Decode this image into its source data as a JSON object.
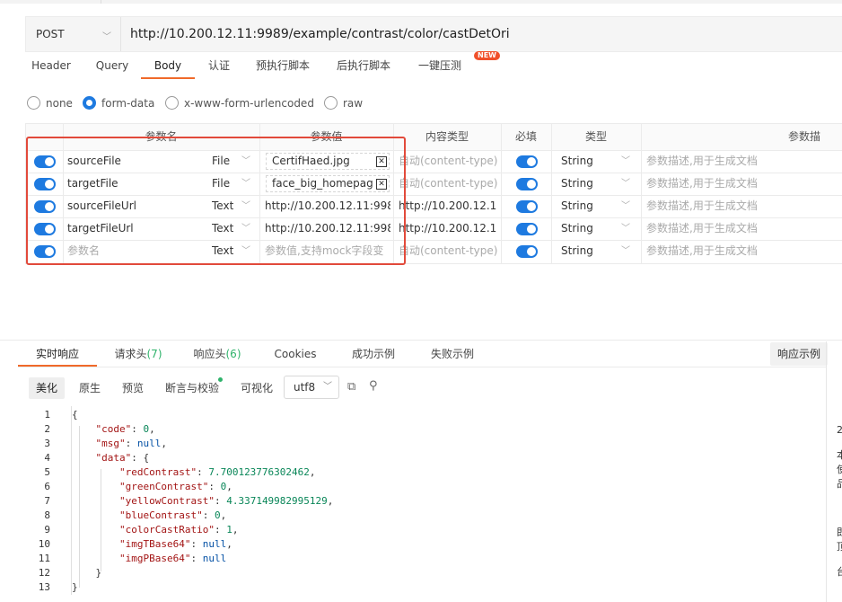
{
  "request": {
    "method": "POST",
    "url": "http://10.200.12.11:9989/example/contrast/color/castDetOri",
    "tabs": [
      "Header",
      "Query",
      "Body",
      "认证",
      "预执行脚本",
      "后执行脚本",
      "一键压测"
    ],
    "active_tab": "Body",
    "new_badge": "NEW"
  },
  "body_modes": {
    "options": [
      "none",
      "form-data",
      "x-www-form-urlencoded",
      "raw"
    ],
    "selected": "form-data"
  },
  "params_table": {
    "headers": [
      "参数名",
      "参数值",
      "内容类型",
      "必填",
      "类型",
      "参数描"
    ],
    "rows": [
      {
        "name": "sourceFile",
        "kind": "File",
        "value": "CertifHaed.jpg",
        "content_type": "自动(content-type)",
        "type": "String",
        "desc": "参数描述,用于生成文档"
      },
      {
        "name": "targetFile",
        "kind": "File",
        "value": "face_big_homepage",
        "content_type": "自动(content-type)",
        "type": "String",
        "desc": "参数描述,用于生成文档"
      },
      {
        "name": "sourceFileUrl",
        "kind": "Text",
        "value": "http://10.200.12.11:998",
        "content_type": "http://10.200.12.1",
        "type": "String",
        "desc": "参数描述,用于生成文档"
      },
      {
        "name": "targetFileUrl",
        "kind": "Text",
        "value": "http://10.200.12.11:998",
        "content_type": "http://10.200.12.1",
        "type": "String",
        "desc": "参数描述,用于生成文档"
      }
    ],
    "new_row": {
      "name_placeholder": "参数名",
      "kind": "Text",
      "value_placeholder": "参数值,支持mock字段变",
      "content_type_placeholder": "自动(content-type)",
      "type": "String",
      "desc_placeholder": "参数描述,用于生成文档"
    }
  },
  "response": {
    "tabs": [
      {
        "label": "实时响应"
      },
      {
        "label": "请求头",
        "count": "(7)"
      },
      {
        "label": "响应头",
        "count": "(6)"
      },
      {
        "label": "Cookies"
      },
      {
        "label": "成功示例"
      },
      {
        "label": "失败示例"
      }
    ],
    "example_button": "响应示例",
    "view_tabs": [
      "美化",
      "原生",
      "预览",
      "断言与校验",
      "可视化"
    ],
    "encoding": "utf8",
    "line_numbers": [
      "1",
      "2",
      "3",
      "4",
      "5",
      "6",
      "7",
      "8",
      "9",
      "10",
      "11",
      "12",
      "13"
    ],
    "json": {
      "code": "0",
      "msg": "null",
      "redContrast": "7.700123776302462",
      "greenContrast": "0",
      "yellowContrast": "4.337149982995129",
      "blueContrast": "0",
      "colorCastRatio": "1",
      "imgTBase64": "null",
      "imgPBase64": "null"
    }
  },
  "right_edge_glyphs": [
    "2",
    "本",
    "使",
    "品",
    "即",
    "顶",
    "台"
  ],
  "colors": {
    "accent": "#1e7ae0",
    "tab_underline": "#f06a2a",
    "highlight_box": "#e24a3b"
  }
}
